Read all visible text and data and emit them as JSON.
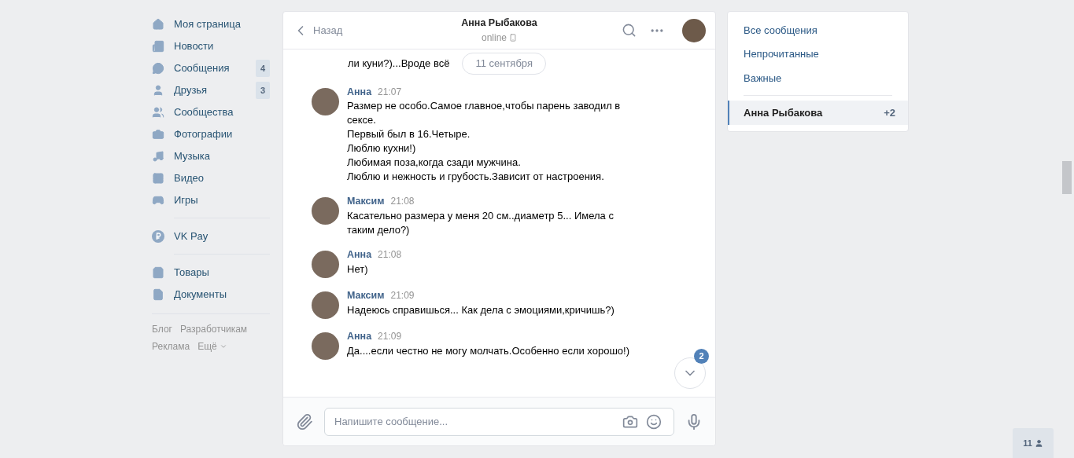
{
  "sidebar": {
    "groups": [
      [
        {
          "label": "Моя страница"
        },
        {
          "label": "Новости"
        },
        {
          "label": "Сообщения",
          "badge": "4"
        },
        {
          "label": "Друзья",
          "badge": "3"
        },
        {
          "label": "Сообщества"
        },
        {
          "label": "Фотографии"
        },
        {
          "label": "Музыка"
        },
        {
          "label": "Видео"
        },
        {
          "label": "Игры"
        }
      ],
      [
        {
          "label": "VK Pay"
        }
      ],
      [
        {
          "label": "Товары"
        },
        {
          "label": "Документы"
        }
      ]
    ],
    "footer": [
      [
        "Блог",
        "Разработчикам"
      ],
      [
        "Реклама",
        "Ещё"
      ]
    ]
  },
  "chat": {
    "back": "Назад",
    "title": "Анна Рыбакова",
    "status": "online",
    "fragment": "ли куни?)...Вроде всё",
    "date": "11 сентября",
    "messages": [
      {
        "author": "Анна",
        "time": "21:07",
        "lines": [
          "Размер не особо.Самое главное,чтобы парень заводил в сексе.",
          "Первый был в 16.Четыре.",
          "Люблю кухни!)",
          "Любимая поза,когда сзади мужчина.",
          "Люблю и нежность и грубость.Зависит от настроения."
        ]
      },
      {
        "author": "Максим",
        "time": "21:08",
        "lines": [
          "Касательно размера у меня 20 см..диаметр 5... Имела с таким дело?)"
        ]
      },
      {
        "author": "Анна",
        "time": "21:08",
        "lines": [
          "Нет)"
        ]
      },
      {
        "author": "Максим",
        "time": "21:09",
        "lines": [
          "Надеюсь справишься... Как дела с эмоциями,кричишь?)"
        ]
      },
      {
        "author": "Анна",
        "time": "21:09",
        "lines": [
          "Да....если честно не могу молчать.Особенно если хорошо!)"
        ]
      }
    ],
    "unread_badge": "2",
    "composer": {
      "placeholder": "Напишите сообщение..."
    }
  },
  "right_panel": {
    "items": [
      {
        "kind": "filter",
        "label": "Все сообщения",
        "selected": false
      },
      {
        "kind": "filter",
        "label": "Непрочитанные",
        "selected": false
      },
      {
        "kind": "filter",
        "label": "Важные",
        "selected": false
      },
      {
        "kind": "chat",
        "label": "Анна Рыбакова",
        "count": "+2",
        "selected": true
      }
    ]
  },
  "online_counter": "11"
}
